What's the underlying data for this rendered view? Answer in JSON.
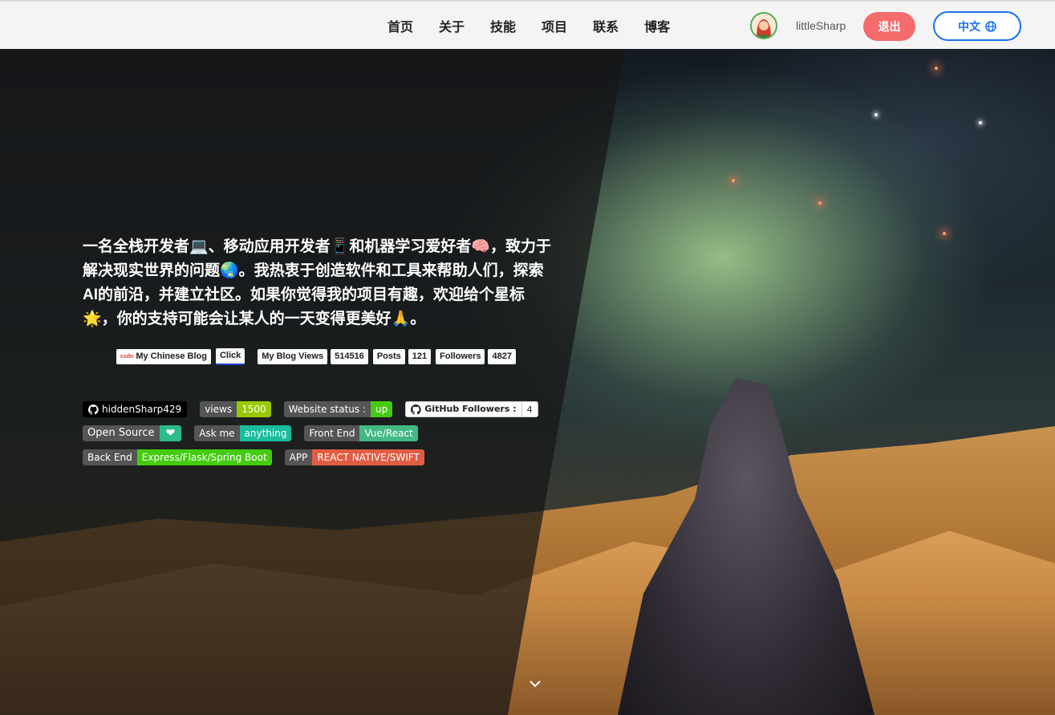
{
  "header": {
    "nav": [
      "首页",
      "关于",
      "技能",
      "项目",
      "联系",
      "博客"
    ],
    "username": "littleSharp",
    "logout_label": "退出",
    "lang_label": "中文",
    "globe_icon": "globe-icon"
  },
  "hero": {
    "intro": "一名全栈开发者💻、移动应用开发者📱和机器学习爱好者🧠，致力于解决现实世界的问题🌏。我热衷于创造软件和工具来帮助人们，探索AI的前沿，并建立社区。如果你觉得我的项目有趣，欢迎给个星标🌟，你的支持可能会让某人的一天变得更美好🙏。",
    "blog_badges": {
      "csdn_logo": "csdn",
      "my_chinese_blog": "My Chinese Blog",
      "click": "Click",
      "my_blog_views": "My Blog Views",
      "views_count": "514516",
      "posts_label": "Posts",
      "posts_count": "121",
      "followers_label": "Followers",
      "followers_count": "4827"
    },
    "shields": [
      {
        "label": "hiddenSharp429",
        "value": "",
        "label_bg": "#000000",
        "value_bg": "",
        "icon": "github-icon"
      },
      {
        "label": "views",
        "value": "1500",
        "label_bg": "#555555",
        "value_bg": "#97ca00"
      },
      {
        "label": "Website status :",
        "value": "up",
        "label_bg": "#555555",
        "value_bg": "#4c1"
      },
      {
        "label": "GitHub Followers :",
        "value": "4",
        "label_bg": "#fafafa",
        "value_bg": "#ffffff",
        "icon": "github-icon"
      },
      {
        "label": "Open Source",
        "value": "❤",
        "label_bg": "#555555",
        "value_bg": "#2bbc8a"
      },
      {
        "label": "Ask me",
        "value": "anything",
        "label_bg": "#555555",
        "value_bg": "#1abc9c"
      },
      {
        "label": "Front End",
        "value": "Vue/React",
        "label_bg": "#555555",
        "value_bg": "#42b983"
      },
      {
        "label": "Back End",
        "value": "Express/Flask/Spring Boot",
        "label_bg": "#555555",
        "value_bg": "#4c1"
      },
      {
        "label": "APP",
        "value": "REACT NATIVE/SWIFT",
        "label_bg": "#555555",
        "value_bg": "#e05d44"
      }
    ],
    "scroll_icon": "chevron-down-icon"
  }
}
